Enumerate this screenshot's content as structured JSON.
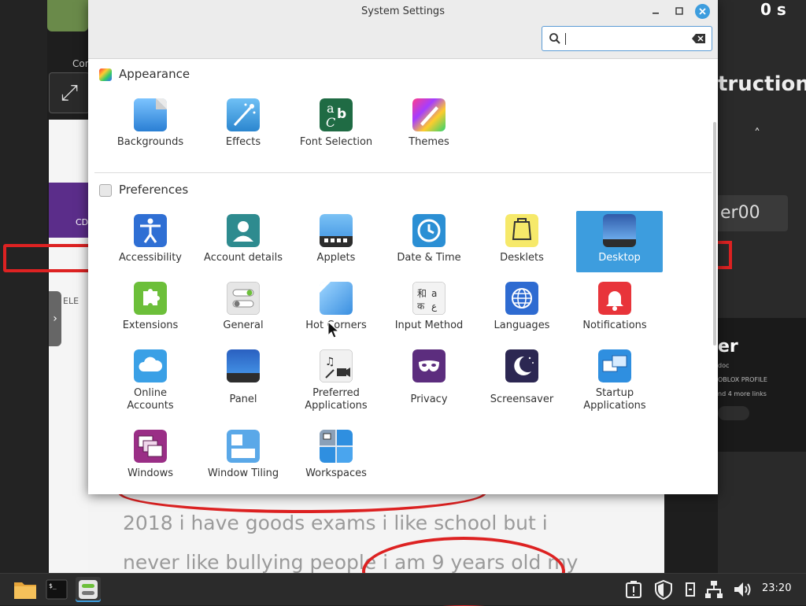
{
  "window": {
    "title": "System Settings",
    "search_value": ""
  },
  "sections": [
    {
      "label": "Appearance",
      "items": [
        {
          "label": "Backgrounds",
          "icon": "backgrounds-icon"
        },
        {
          "label": "Effects",
          "icon": "effects-icon"
        },
        {
          "label": "Font Selection",
          "icon": "font-selection-icon"
        },
        {
          "label": "Themes",
          "icon": "themes-icon"
        }
      ]
    },
    {
      "label": "Preferences",
      "items": [
        {
          "label": "Accessibility",
          "icon": "accessibility-icon"
        },
        {
          "label": "Account details",
          "icon": "account-details-icon"
        },
        {
          "label": "Applets",
          "icon": "applets-icon"
        },
        {
          "label": "Date & Time",
          "icon": "date-time-icon"
        },
        {
          "label": "Desklets",
          "icon": "desklets-icon"
        },
        {
          "label": "Desktop",
          "icon": "desktop-icon",
          "selected": true
        },
        {
          "label": "Extensions",
          "icon": "extensions-icon"
        },
        {
          "label": "General",
          "icon": "general-icon"
        },
        {
          "label": "Hot Corners",
          "icon": "hot-corners-icon"
        },
        {
          "label": "Input Method",
          "icon": "input-method-icon"
        },
        {
          "label": "Languages",
          "icon": "languages-icon"
        },
        {
          "label": "Notifications",
          "icon": "notifications-icon"
        },
        {
          "label": "Online\nAccounts",
          "icon": "online-accounts-icon"
        },
        {
          "label": "Panel",
          "icon": "panel-icon"
        },
        {
          "label": "Preferred\nApplications",
          "icon": "preferred-applications-icon"
        },
        {
          "label": "Privacy",
          "icon": "privacy-icon"
        },
        {
          "label": "Screensaver",
          "icon": "screensaver-icon"
        },
        {
          "label": "Startup\nApplications",
          "icon": "startup-applications-icon"
        },
        {
          "label": "Windows",
          "icon": "windows-icon"
        },
        {
          "label": "Window Tiling",
          "icon": "window-tiling-icon"
        },
        {
          "label": "Workspaces",
          "icon": "workspaces-icon"
        }
      ]
    }
  ],
  "background": {
    "left_label_con": "Con",
    "left_label_cd": "CD",
    "left_label_ele": "ELE",
    "right_title": "tructions",
    "right_badge": "0 s",
    "right_field": "er00",
    "right_card_title": "er",
    "right_card_line1": "doc",
    "right_card_line2": "OBLOX PROFILE",
    "right_card_line3": "nd 4 more links",
    "doc_line1": "2018 i have goods exams i like school but i",
    "doc_line2": "never like bullying people i am 9 years old my"
  },
  "taskbar": {
    "clock": "23:20",
    "apps": [
      "file-manager",
      "terminal",
      "system-settings"
    ]
  },
  "colors": {
    "accent": "#3d9dde",
    "annotation_red": "#d22222"
  }
}
